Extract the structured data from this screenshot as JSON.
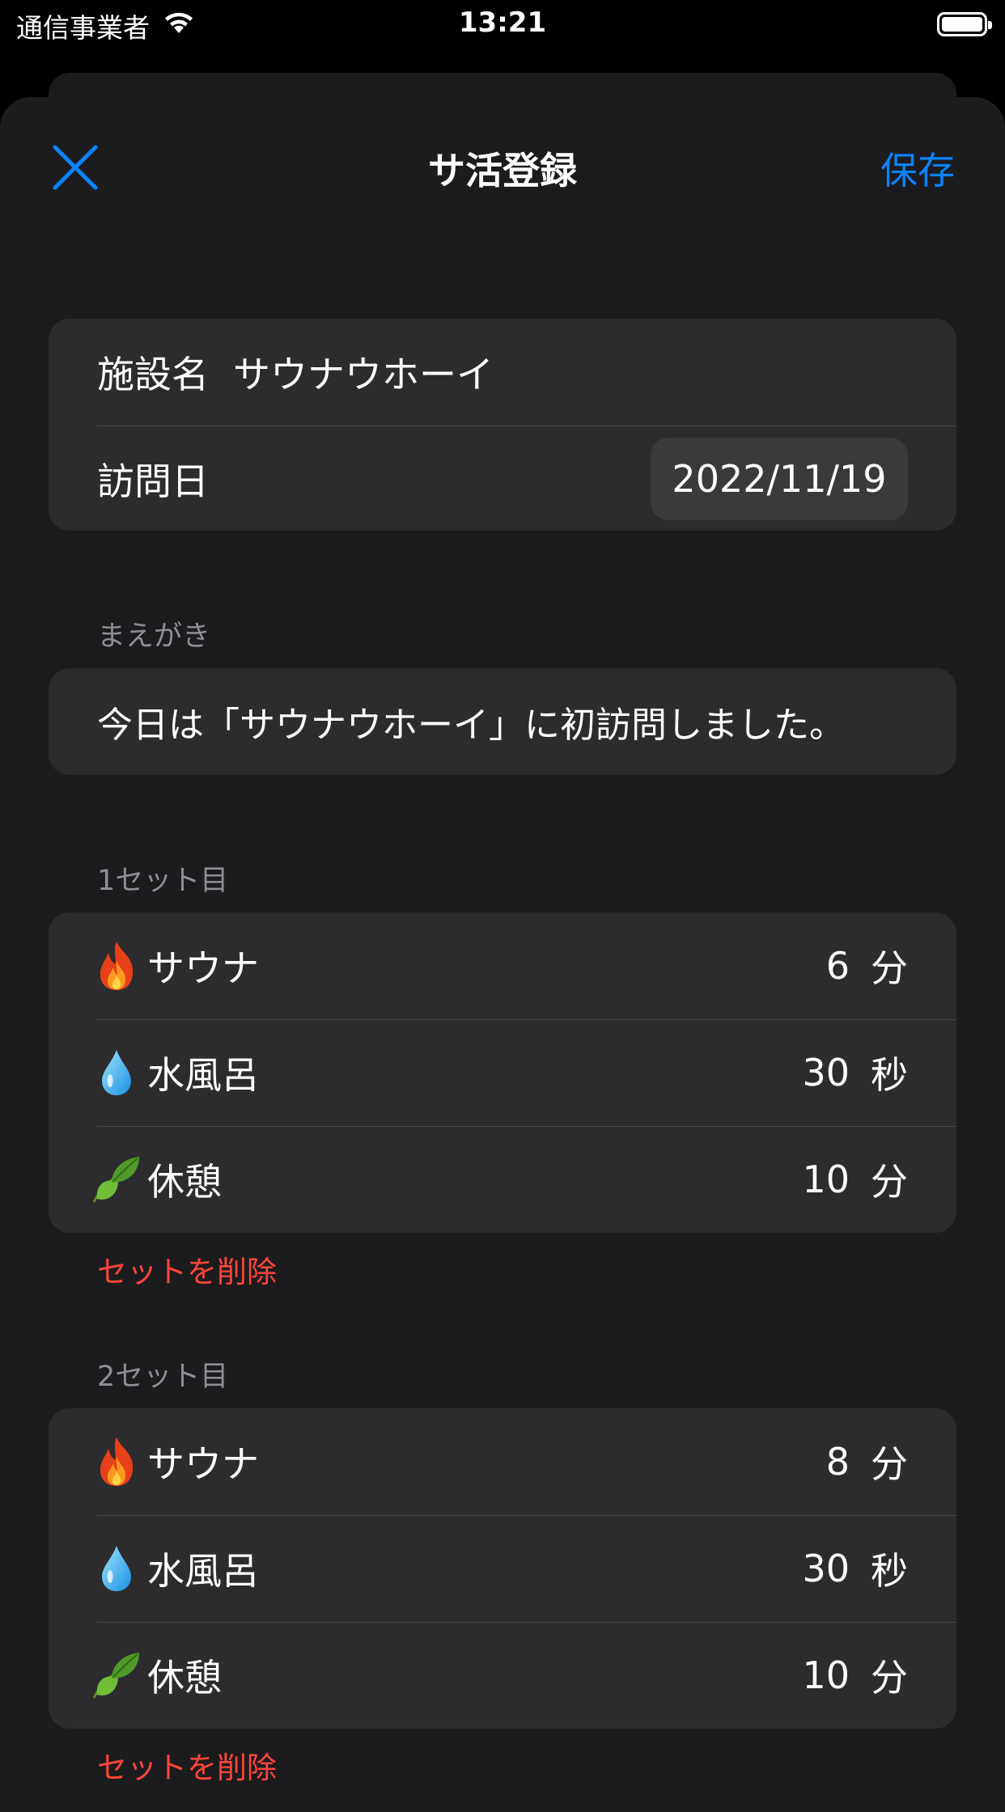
{
  "status_bar": {
    "carrier": "通信事業者",
    "time": "13:21"
  },
  "nav": {
    "title": "サ活登録",
    "save_label": "保存",
    "close_icon": "close-x-icon"
  },
  "colors": {
    "accent": "#0a84ff",
    "destructive": "#ff453a",
    "sheet_bg": "#1c1c1e",
    "cell_bg": "#2c2c2e"
  },
  "facility": {
    "label": "施設名",
    "value": "サウナウホーイ"
  },
  "visit": {
    "label": "訪問日",
    "date": "2022/11/19"
  },
  "preface": {
    "header": "まえがき",
    "text": "今日は「サウナウホーイ」に初訪問しました。"
  },
  "sets": [
    {
      "header": "1セット目",
      "rows": [
        {
          "icon": "fire-icon",
          "name": "サウナ",
          "value": "6",
          "unit": "分"
        },
        {
          "icon": "water-drop-icon",
          "name": "水風呂",
          "value": "30",
          "unit": "秒"
        },
        {
          "icon": "leaf-icon",
          "name": "休憩",
          "value": "10",
          "unit": "分"
        }
      ],
      "delete_label": "セットを削除"
    },
    {
      "header": "2セット目",
      "rows": [
        {
          "icon": "fire-icon",
          "name": "サウナ",
          "value": "8",
          "unit": "分"
        },
        {
          "icon": "water-drop-icon",
          "name": "水風呂",
          "value": "30",
          "unit": "秒"
        },
        {
          "icon": "leaf-icon",
          "name": "休憩",
          "value": "10",
          "unit": "分"
        }
      ],
      "delete_label": "セットを削除"
    }
  ]
}
